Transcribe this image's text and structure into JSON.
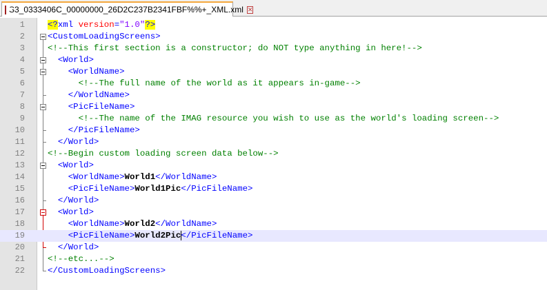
{
  "tab": {
    "title": "S3_0333406C_00000000_26D2C237B2341FBF%%+_XML.xml",
    "close_glyph": "✕"
  },
  "lines": [
    {
      "no": "1",
      "segs": [
        {
          "c": "hl c-b",
          "t": "<?"
        },
        {
          "c": "c-b",
          "t": "xml "
        },
        {
          "c": "c-r",
          "t": "version"
        },
        {
          "c": "c-b",
          "t": "="
        },
        {
          "c": "c-p",
          "t": "\"1.0\""
        },
        {
          "c": "hl c-b",
          "t": "?>"
        }
      ]
    },
    {
      "no": "2",
      "segs": [
        {
          "c": "c-b",
          "t": "<CustomLoadingScreens>"
        }
      ]
    },
    {
      "no": "3",
      "segs": [
        {
          "c": "c-g",
          "t": "<!--This first section is a constructor; do NOT type anything in here!-->"
        }
      ]
    },
    {
      "no": "4",
      "segs": [
        {
          "c": "",
          "t": "  "
        },
        {
          "c": "c-b",
          "t": "<World>"
        }
      ]
    },
    {
      "no": "5",
      "segs": [
        {
          "c": "",
          "t": "    "
        },
        {
          "c": "c-b",
          "t": "<WorldName>"
        }
      ]
    },
    {
      "no": "6",
      "segs": [
        {
          "c": "",
          "t": "      "
        },
        {
          "c": "c-g",
          "t": "<!--The full name of the world as it appears in-game-->"
        }
      ]
    },
    {
      "no": "7",
      "segs": [
        {
          "c": "",
          "t": "    "
        },
        {
          "c": "c-b",
          "t": "</WorldName>"
        }
      ]
    },
    {
      "no": "8",
      "segs": [
        {
          "c": "",
          "t": "    "
        },
        {
          "c": "c-b",
          "t": "<PicFileName>"
        }
      ]
    },
    {
      "no": "9",
      "segs": [
        {
          "c": "",
          "t": "      "
        },
        {
          "c": "c-g",
          "t": "<!--The name of the IMAG resource you wish to use as the world's loading screen-->"
        }
      ]
    },
    {
      "no": "10",
      "segs": [
        {
          "c": "",
          "t": "    "
        },
        {
          "c": "c-b",
          "t": "</PicFileName>"
        }
      ]
    },
    {
      "no": "11",
      "segs": [
        {
          "c": "",
          "t": "  "
        },
        {
          "c": "c-b",
          "t": "</World>"
        }
      ]
    },
    {
      "no": "12",
      "segs": [
        {
          "c": "c-g",
          "t": "<!--Begin custom loading screen data below-->"
        }
      ]
    },
    {
      "no": "13",
      "segs": [
        {
          "c": "",
          "t": "  "
        },
        {
          "c": "c-b",
          "t": "<World>"
        }
      ]
    },
    {
      "no": "14",
      "segs": [
        {
          "c": "",
          "t": "    "
        },
        {
          "c": "c-b",
          "t": "<WorldName>"
        },
        {
          "c": "c-t",
          "t": "World1"
        },
        {
          "c": "c-b",
          "t": "</WorldName>"
        }
      ]
    },
    {
      "no": "15",
      "segs": [
        {
          "c": "",
          "t": "    "
        },
        {
          "c": "c-b",
          "t": "<PicFileName>"
        },
        {
          "c": "c-t",
          "t": "World1Pic"
        },
        {
          "c": "c-b",
          "t": "</PicFileName>"
        }
      ]
    },
    {
      "no": "16",
      "segs": [
        {
          "c": "",
          "t": "  "
        },
        {
          "c": "c-b",
          "t": "</World>"
        }
      ]
    },
    {
      "no": "17",
      "segs": [
        {
          "c": "",
          "t": "  "
        },
        {
          "c": "c-b",
          "t": "<World>"
        }
      ]
    },
    {
      "no": "18",
      "segs": [
        {
          "c": "",
          "t": "    "
        },
        {
          "c": "c-b",
          "t": "<WorldName>"
        },
        {
          "c": "c-t",
          "t": "World2"
        },
        {
          "c": "c-b",
          "t": "</WorldName>"
        }
      ]
    },
    {
      "no": "19",
      "segs": [
        {
          "c": "",
          "t": "    "
        },
        {
          "c": "c-b",
          "t": "<PicFileName>"
        },
        {
          "c": "c-t",
          "t": "World2Pic"
        },
        {
          "caret": true
        },
        {
          "c": "c-b",
          "t": "</PicFileName>"
        }
      ]
    },
    {
      "no": "20",
      "segs": [
        {
          "c": "",
          "t": "  "
        },
        {
          "c": "c-b",
          "t": "</World>"
        }
      ]
    },
    {
      "no": "21",
      "segs": [
        {
          "c": "c-g",
          "t": "<!--etc...-->"
        }
      ]
    },
    {
      "no": "22",
      "segs": [
        {
          "c": "c-b",
          "t": "</CustomLoadingScreens>"
        }
      ]
    }
  ],
  "current_line": 19,
  "colors": {
    "tag": "#0000ff",
    "attr": "#ff0000",
    "value": "#8000ff",
    "comment": "#008000",
    "text": "#000000",
    "current_line": "#e8e8ff",
    "highlight": "#ffff00"
  }
}
